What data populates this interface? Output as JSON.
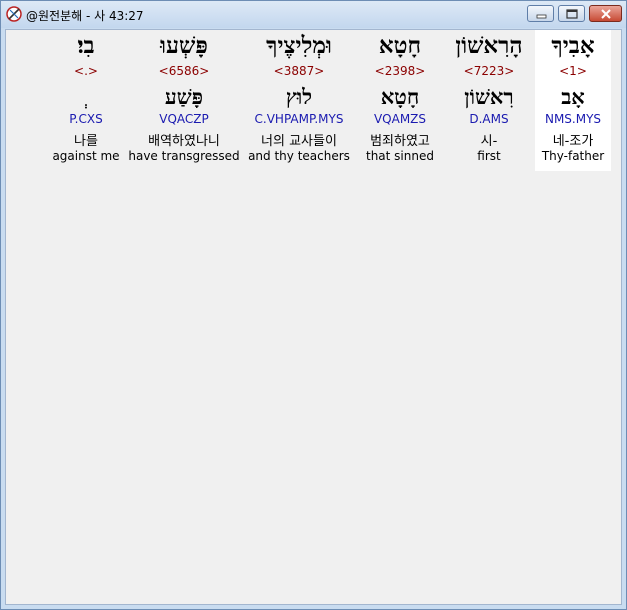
{
  "window": {
    "title": "@원전분해 - 사 43:27",
    "icon": "pencil-compass-icon"
  },
  "words": [
    {
      "hebrew": "אָבִיךָ",
      "strong": "<1>",
      "lemma": "אָב",
      "parse": "NMS.MYS",
      "korean": "네-조가",
      "english": "Thy-father",
      "selected": true
    },
    {
      "hebrew": "הָרִאשׁוֹן",
      "strong": "<7223>",
      "lemma": "רִאשׁוֹן",
      "parse": "D.AMS",
      "korean": "시-",
      "english": "first",
      "selected": false
    },
    {
      "hebrew": "חָטָא",
      "strong": "<2398>",
      "lemma": "חָטָא",
      "parse": "VQAMZS",
      "korean": "범죄하였고",
      "english": "that sinned",
      "selected": false
    },
    {
      "hebrew": "וּמְלִיצֶיךָ",
      "strong": "<3887>",
      "lemma": "לוּץ",
      "parse": "C.VHPAMP.MYS",
      "korean": "너의 교사들이",
      "english": "and thy teachers",
      "selected": false
    },
    {
      "hebrew": "פָּשְׁעוּ",
      "strong": "<6586>",
      "lemma": "פָּשַׁע",
      "parse": "VQACZP",
      "korean": "배역하였나니",
      "english": "have transgressed",
      "selected": false
    },
    {
      "hebrew": "בִי׃",
      "strong": "<.>",
      "lemma": "ְ",
      "parse": "P.CXS",
      "korean": "나를",
      "english": "against me",
      "selected": false
    }
  ]
}
